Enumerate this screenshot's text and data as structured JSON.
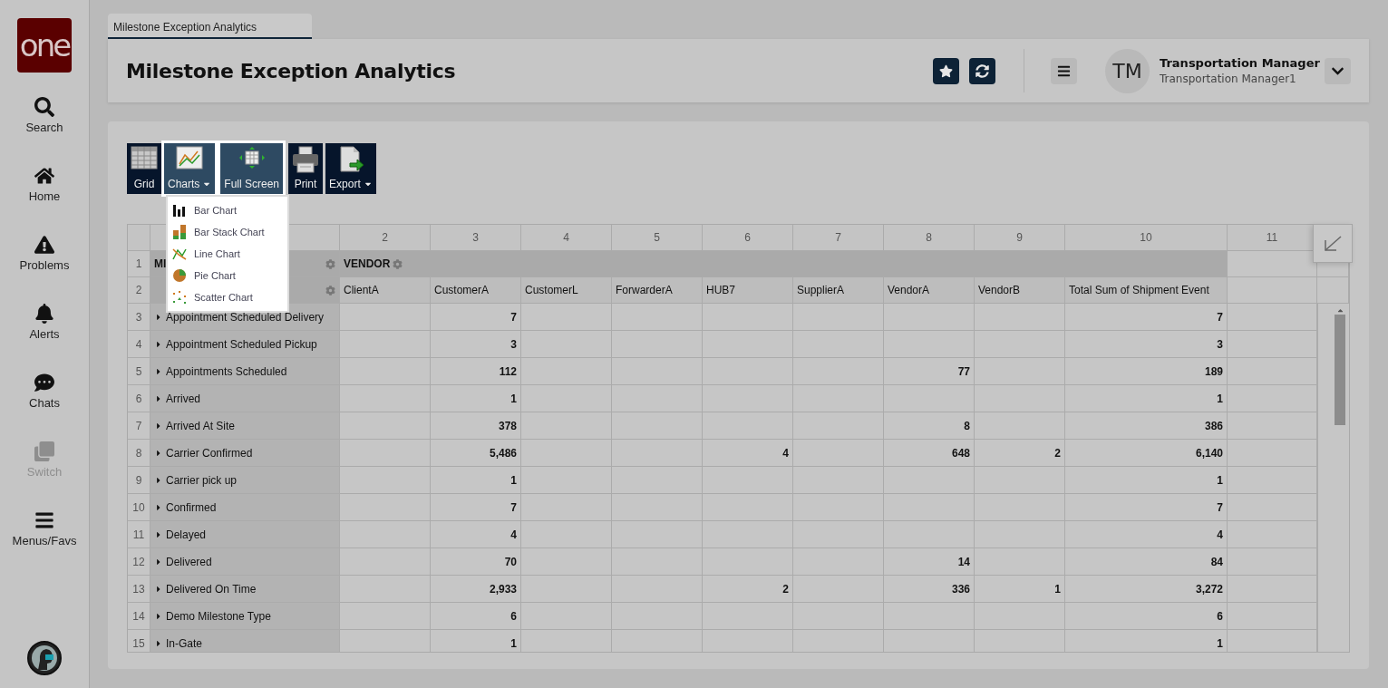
{
  "sidebar": {
    "logo": "one",
    "items": [
      {
        "label": "Search",
        "kind": "search",
        "disabled": false
      },
      {
        "label": "Home",
        "kind": "home",
        "disabled": false
      },
      {
        "label": "Problems",
        "kind": "warning",
        "disabled": false
      },
      {
        "label": "Alerts",
        "kind": "bell",
        "disabled": false
      },
      {
        "label": "Chats",
        "kind": "chat",
        "disabled": false
      },
      {
        "label": "Switch",
        "kind": "switch",
        "disabled": true
      },
      {
        "label": "Menus/Favs",
        "kind": "menu",
        "disabled": false
      }
    ]
  },
  "tabs": [
    {
      "label": "Milestone Exception Analytics",
      "selected": true
    }
  ],
  "header": {
    "title": "Milestone Exception Analytics",
    "user": {
      "initials": "TM",
      "name": "Transportation Manager",
      "role": "Transportation Manager1"
    }
  },
  "toolbar": [
    {
      "label": "Grid",
      "kind": "grid",
      "highlighted": false,
      "dropdown": false
    },
    {
      "label": "Charts",
      "kind": "charts",
      "highlighted": true,
      "dropdown": true
    },
    {
      "label": "Full Screen",
      "kind": "fullscreen",
      "highlighted": true,
      "dropdown": false
    },
    {
      "label": "Print",
      "kind": "print",
      "highlighted": false,
      "dropdown": false
    },
    {
      "label": "Export",
      "kind": "export",
      "highlighted": false,
      "dropdown": true
    }
  ],
  "charts_menu": [
    {
      "label": "Bar Chart",
      "kind": "bar"
    },
    {
      "label": "Bar Stack Chart",
      "kind": "stack"
    },
    {
      "label": "Line Chart",
      "kind": "line"
    },
    {
      "label": "Pie Chart",
      "kind": "pie"
    },
    {
      "label": "Scatter Chart",
      "kind": "scatter"
    }
  ],
  "table": {
    "column_numbers": [
      "2",
      "3",
      "4",
      "5",
      "6",
      "7",
      "8",
      "9",
      "10",
      "11"
    ],
    "row_1": {
      "number": "1",
      "row_field": "MI",
      "column_field": "VENDOR"
    },
    "row_2": {
      "number": "2",
      "columns": [
        "ClientA",
        "CustomerA",
        "CustomerL",
        "ForwarderA",
        "HUB7",
        "SupplierA",
        "VendorA",
        "VendorB",
        "Total Sum of Shipment Event"
      ]
    },
    "rows": [
      {
        "number": "3",
        "label": "Appointment Scheduled Delivery",
        "cells": {
          "column_3": "7",
          "column_10": "7"
        }
      },
      {
        "number": "4",
        "label": "Appointment Scheduled Pickup",
        "cells": {
          "column_3": "3",
          "column_10": "3"
        }
      },
      {
        "number": "5",
        "label": "Appointments Scheduled",
        "cells": {
          "column_3": "112",
          "column_8": "77",
          "column_10": "189"
        }
      },
      {
        "number": "6",
        "label": "Arrived",
        "cells": {
          "column_3": "1",
          "column_10": "1"
        }
      },
      {
        "number": "7",
        "label": "Arrived At Site",
        "cells": {
          "column_3": "378",
          "column_8": "8",
          "column_10": "386"
        }
      },
      {
        "number": "8",
        "label": "Carrier Confirmed",
        "cells": {
          "column_3": "5,486",
          "column_6": "4",
          "column_8": "648",
          "column_9": "2",
          "column_10": "6,140"
        }
      },
      {
        "number": "9",
        "label": "Carrier pick up",
        "cells": {
          "column_3": "1",
          "column_10": "1"
        }
      },
      {
        "number": "10",
        "label": "Confirmed",
        "cells": {
          "column_3": "7",
          "column_10": "7"
        }
      },
      {
        "number": "11",
        "label": "Delayed",
        "cells": {
          "column_3": "4",
          "column_10": "4"
        }
      },
      {
        "number": "12",
        "label": "Delivered",
        "cells": {
          "column_3": "70",
          "column_8": "14",
          "column_10": "84"
        }
      },
      {
        "number": "13",
        "label": "Delivered On Time",
        "cells": {
          "column_3": "2,933",
          "column_6": "2",
          "column_8": "336",
          "column_9": "1",
          "column_10": "3,272"
        }
      },
      {
        "number": "14",
        "label": "Demo Milestone Type",
        "cells": {
          "column_3": "6",
          "column_10": "6"
        }
      },
      {
        "number": "15",
        "label": "In-Gate",
        "cells": {
          "column_3": "1",
          "column_10": "1"
        }
      }
    ]
  }
}
